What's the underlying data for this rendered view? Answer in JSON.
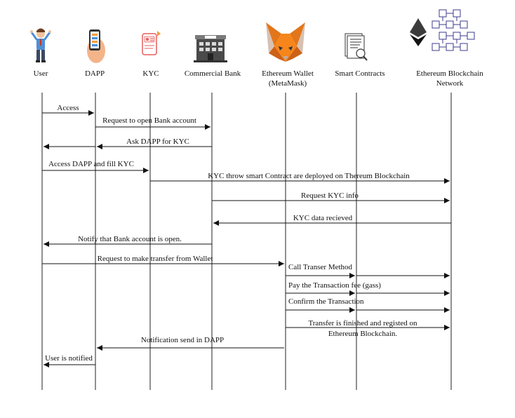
{
  "actors": [
    {
      "id": "user",
      "label_lines": [
        "User"
      ],
      "icon": "user-icon"
    },
    {
      "id": "dapp",
      "label_lines": [
        "DAPP"
      ],
      "icon": "phone-app-icon"
    },
    {
      "id": "kyc",
      "label_lines": [
        "KYC"
      ],
      "icon": "kyc-phone-icon"
    },
    {
      "id": "bank",
      "label_lines": [
        "Commercial Bank"
      ],
      "icon": "bank-building-icon"
    },
    {
      "id": "wallet",
      "label_lines": [
        "Ethereum Wallet",
        "(MetaMask)"
      ],
      "icon": "metamask-fox-icon"
    },
    {
      "id": "contracts",
      "label_lines": [
        "Smart Contracts"
      ],
      "icon": "contract-document-icon"
    },
    {
      "id": "chain",
      "label_lines": [
        "Ethereum Blockchain",
        "Network"
      ],
      "icon": "ethereum-blockchain-icon"
    }
  ],
  "messages": [
    {
      "from": "user",
      "to": "dapp",
      "label_lines": [
        "Access"
      ]
    },
    {
      "from": "dapp",
      "to": "bank",
      "label_lines": [
        "Request to open Bank account"
      ]
    },
    {
      "from": "bank",
      "to": "dapp",
      "label_lines": [
        "Ask DAPP for KYC"
      ]
    },
    {
      "from": "dapp",
      "to": "user",
      "label_lines": []
    },
    {
      "from": "user",
      "to": "kyc",
      "label_lines": [
        "Access DAPP and fill KYC"
      ]
    },
    {
      "from": "kyc",
      "to": "chain",
      "label_lines": [
        "KYC throw smart Contract are deployed on Thereum Blockchain"
      ]
    },
    {
      "from": "bank",
      "to": "chain",
      "label_lines": [
        "Request KYC info"
      ]
    },
    {
      "from": "chain",
      "to": "bank",
      "label_lines": [
        "KYC data recieved"
      ]
    },
    {
      "from": "bank",
      "to": "user",
      "label_lines": [
        "Notify that Bank account is open."
      ]
    },
    {
      "from": "user",
      "to": "wallet",
      "label_lines": [
        "Request to make transfer from Wallet"
      ]
    },
    {
      "from": "wallet",
      "to": "chain",
      "label_lines": [
        "Call Transer Method"
      ],
      "via": "contracts"
    },
    {
      "from": "wallet",
      "to": "chain",
      "label_lines": [
        "Pay the Transaction fee (gass)"
      ],
      "via": "contracts"
    },
    {
      "from": "wallet",
      "to": "chain",
      "label_lines": [
        "Confirm the Transaction"
      ],
      "via": "contracts"
    },
    {
      "from": "wallet",
      "to": "chain",
      "label_lines": [
        "Transfer is finished and registed on",
        "Ethereum Blockchain."
      ]
    },
    {
      "from": "wallet",
      "to": "dapp",
      "label_lines": [
        "Notification send in DAPP"
      ]
    },
    {
      "from": "dapp",
      "to": "user",
      "label_lines": [
        "User is notified"
      ]
    }
  ]
}
